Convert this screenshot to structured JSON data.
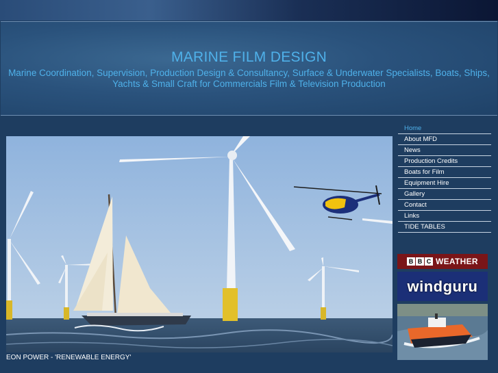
{
  "header": {
    "title": "MARINE FILM DESIGN",
    "tagline": "Marine Coordination, Supervision, Production Design & Consultancy, Surface & Underwater Specialists, Boats, Ships, Yachts & Small Craft for Commercials Film & Television Production"
  },
  "nav": {
    "items": [
      {
        "label": "Home",
        "active": true
      },
      {
        "label": "About MFD"
      },
      {
        "label": "News"
      },
      {
        "label": "Production Credits"
      },
      {
        "label": "Boats for Film"
      },
      {
        "label": "Equipment Hire"
      },
      {
        "label": "Gallery"
      },
      {
        "label": "Contact"
      },
      {
        "label": "Links"
      },
      {
        "label": "TIDE TABLES"
      }
    ]
  },
  "photo": {
    "caption": "EON POWER - 'RENEWABLE ENERGY'"
  },
  "badges": {
    "bbc_letters": [
      "B",
      "B",
      "C"
    ],
    "bbc_word": "WEATHER",
    "windguru": "windguru"
  },
  "colors": {
    "page_bg": "#1e3d60",
    "accent": "#4fb1ea",
    "bbc_red": "#7a1518",
    "windguru_blue": "#1b2f77"
  }
}
